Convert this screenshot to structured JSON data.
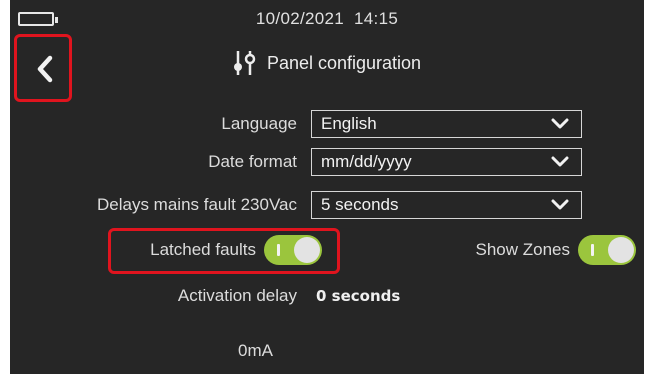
{
  "status_bar": {
    "icon": "battery-icon",
    "date": "10/02/2021",
    "time": "14:15"
  },
  "header": {
    "back_icon": "chevron-left-icon",
    "title_icon": "sliders-icon",
    "title": "Panel configuration"
  },
  "settings": {
    "language": {
      "label": "Language",
      "value": "English"
    },
    "date_format": {
      "label": "Date format",
      "value": "mm/dd/yyyy"
    },
    "mains_fault_delay": {
      "label": "Delays mains fault 230Vac",
      "value": "5 seconds"
    },
    "latched_faults": {
      "label": "Latched faults",
      "enabled": true
    },
    "show_zones": {
      "label": "Show Zones",
      "enabled": true
    },
    "activation_delay": {
      "label": "Activation delay",
      "value": "0 seconds"
    },
    "current": {
      "value": "0mA"
    }
  },
  "colors": {
    "screen_bg": "#262626",
    "highlight": "#e0141e",
    "toggle_on": "#9bc53d"
  }
}
